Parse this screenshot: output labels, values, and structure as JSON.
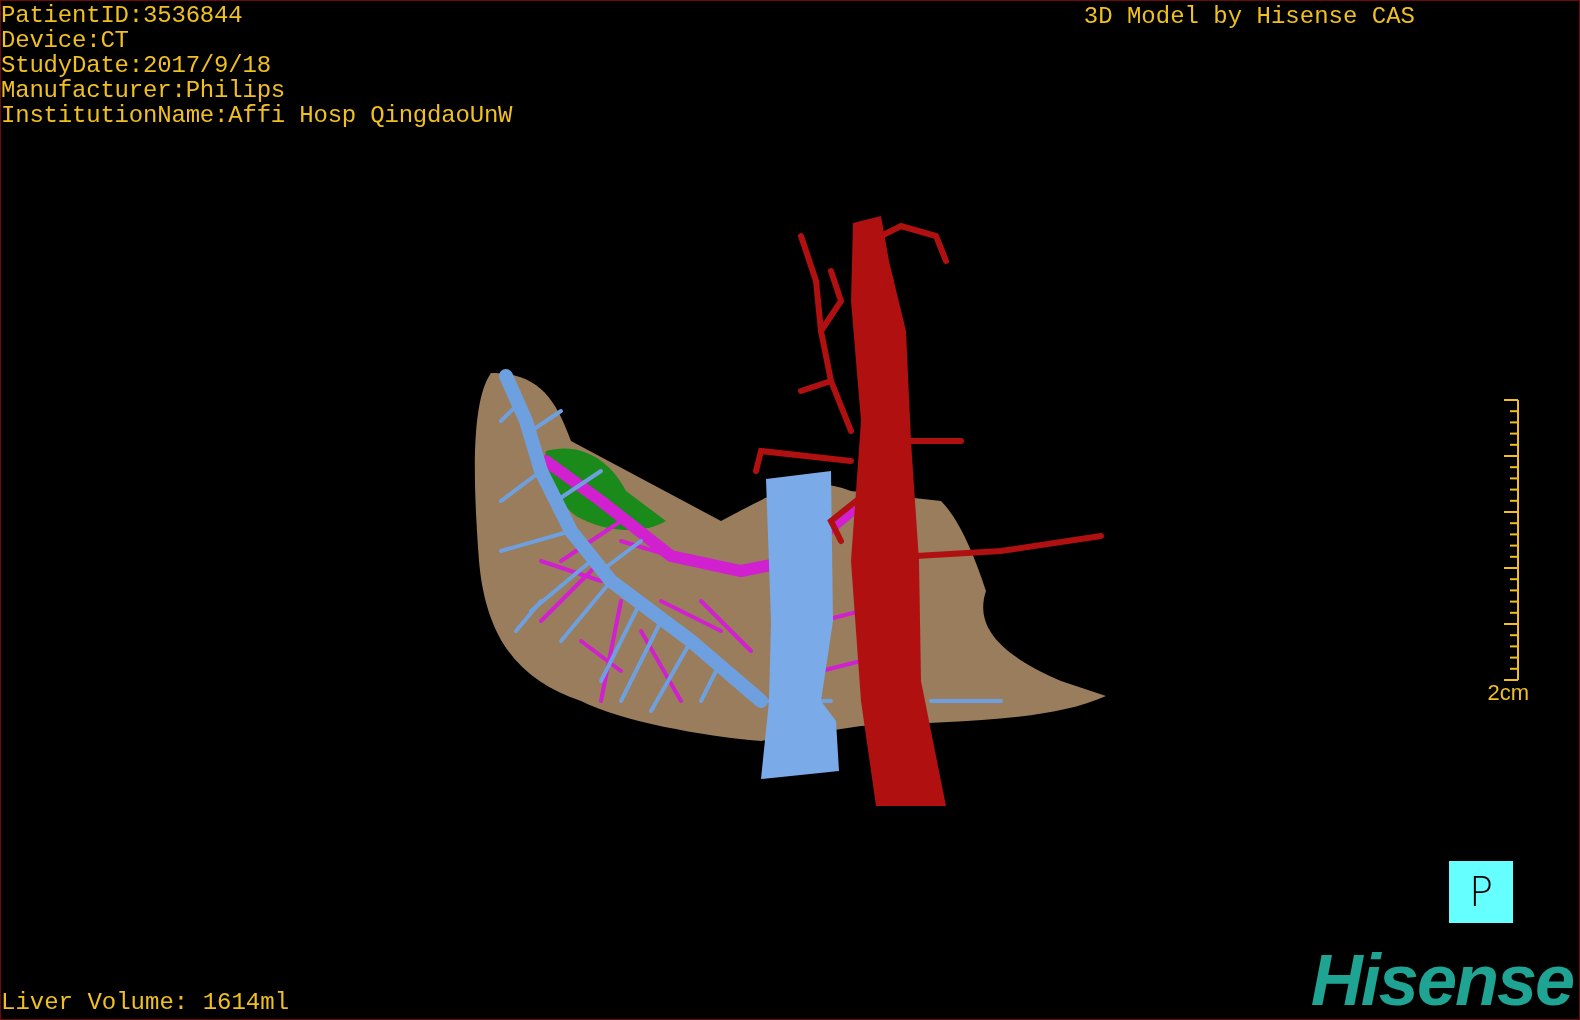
{
  "patient_info": [
    "PatientID:3536844",
    "Device:CT",
    "StudyDate:2017/9/18",
    "Manufacturer:Philips",
    "InstitutionName:Affi Hosp QingdaoUnW"
  ],
  "title": "3D Model by Hisense CAS",
  "scale": {
    "label": "2cm"
  },
  "liver_volume": "Liver Volume: 1614ml",
  "orientation_marker": "P",
  "logo": "Hisense"
}
